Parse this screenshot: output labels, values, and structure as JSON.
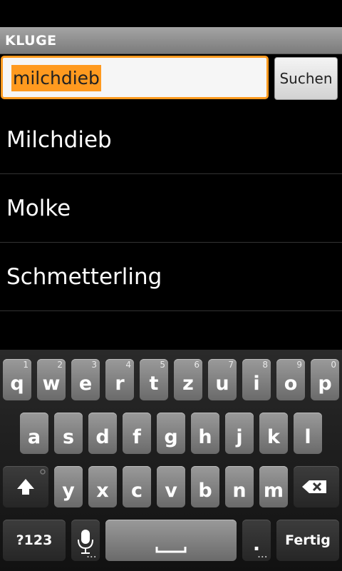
{
  "app": {
    "title": "KLUGE"
  },
  "search": {
    "query": "milchdieb",
    "button_label": "Suchen"
  },
  "results": [
    "Milchdieb",
    "Molke",
    "Schmetterling"
  ],
  "keyboard": {
    "row1": [
      {
        "k": "q",
        "h": "1"
      },
      {
        "k": "w",
        "h": "2"
      },
      {
        "k": "e",
        "h": "3"
      },
      {
        "k": "r",
        "h": "4"
      },
      {
        "k": "t",
        "h": "5"
      },
      {
        "k": "z",
        "h": "6"
      },
      {
        "k": "u",
        "h": "7"
      },
      {
        "k": "i",
        "h": "8"
      },
      {
        "k": "o",
        "h": "9"
      },
      {
        "k": "p",
        "h": "0"
      }
    ],
    "row2": [
      "a",
      "s",
      "d",
      "f",
      "g",
      "h",
      "j",
      "k",
      "l"
    ],
    "row3": [
      "y",
      "x",
      "c",
      "v",
      "b",
      "n",
      "m"
    ],
    "symbols_label": "?123",
    "period": ".",
    "done_label": "Fertig",
    "shift_icon": "shift-arrow-icon",
    "backspace_icon": "backspace-icon",
    "mic_icon": "microphone-icon",
    "space_icon": "space-bar-icon"
  }
}
